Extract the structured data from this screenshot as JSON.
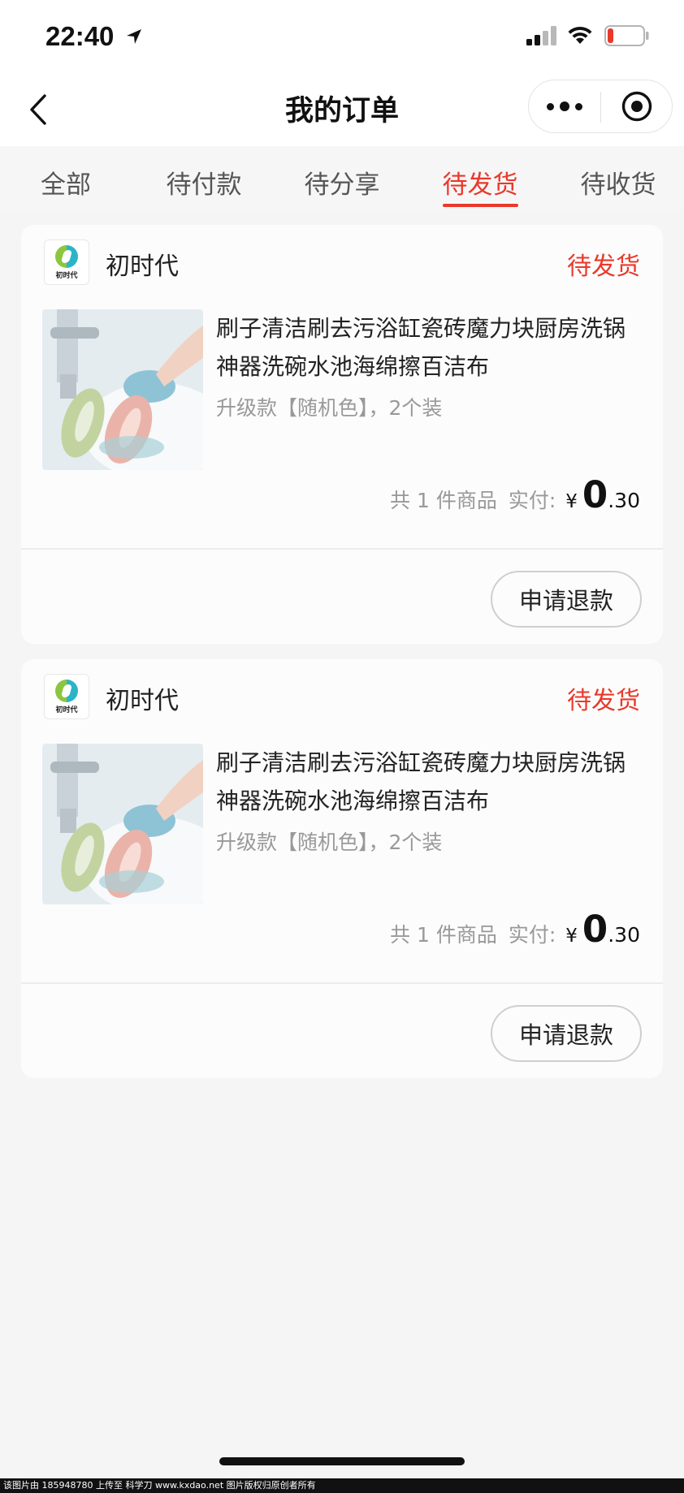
{
  "status_bar": {
    "time": "22:40"
  },
  "nav": {
    "title": "我的订单"
  },
  "tabs": [
    {
      "label": "全部"
    },
    {
      "label": "待付款"
    },
    {
      "label": "待分享"
    },
    {
      "label": "待发货"
    },
    {
      "label": "待收货"
    }
  ],
  "active_tab": "待发货",
  "orders": [
    {
      "shop_name": "初时代",
      "shop_logo_text": "初时代",
      "status": "待发货",
      "product_title": "刷子清洁刷去污浴缸瓷砖魔力块厨房洗锅神器洗碗水池海绵擦百洁布",
      "product_spec": "升级款【随机色】，2个装",
      "count_text": "共 1 件商品",
      "paid_label": "实付:",
      "currency": "¥",
      "price_int": "0",
      "price_dec": ".30",
      "refund_label": "申请退款"
    },
    {
      "shop_name": "初时代",
      "shop_logo_text": "初时代",
      "status": "待发货",
      "product_title": "刷子清洁刷去污浴缸瓷砖魔力块厨房洗锅神器洗碗水池海绵擦百洁布",
      "product_spec": "升级款【随机色】，2个装",
      "count_text": "共 1 件商品",
      "paid_label": "实付:",
      "currency": "¥",
      "price_int": "0",
      "price_dec": ".30",
      "refund_label": "申请退款"
    }
  ],
  "watermark": "该图片由 185948780 上传至 科学刀 www.kxdao.net 图片版权归原创者所有",
  "colors": {
    "accent": "#e9392b",
    "page_bg": "#f5f5f5",
    "card_bg": "#fcfcfc"
  }
}
